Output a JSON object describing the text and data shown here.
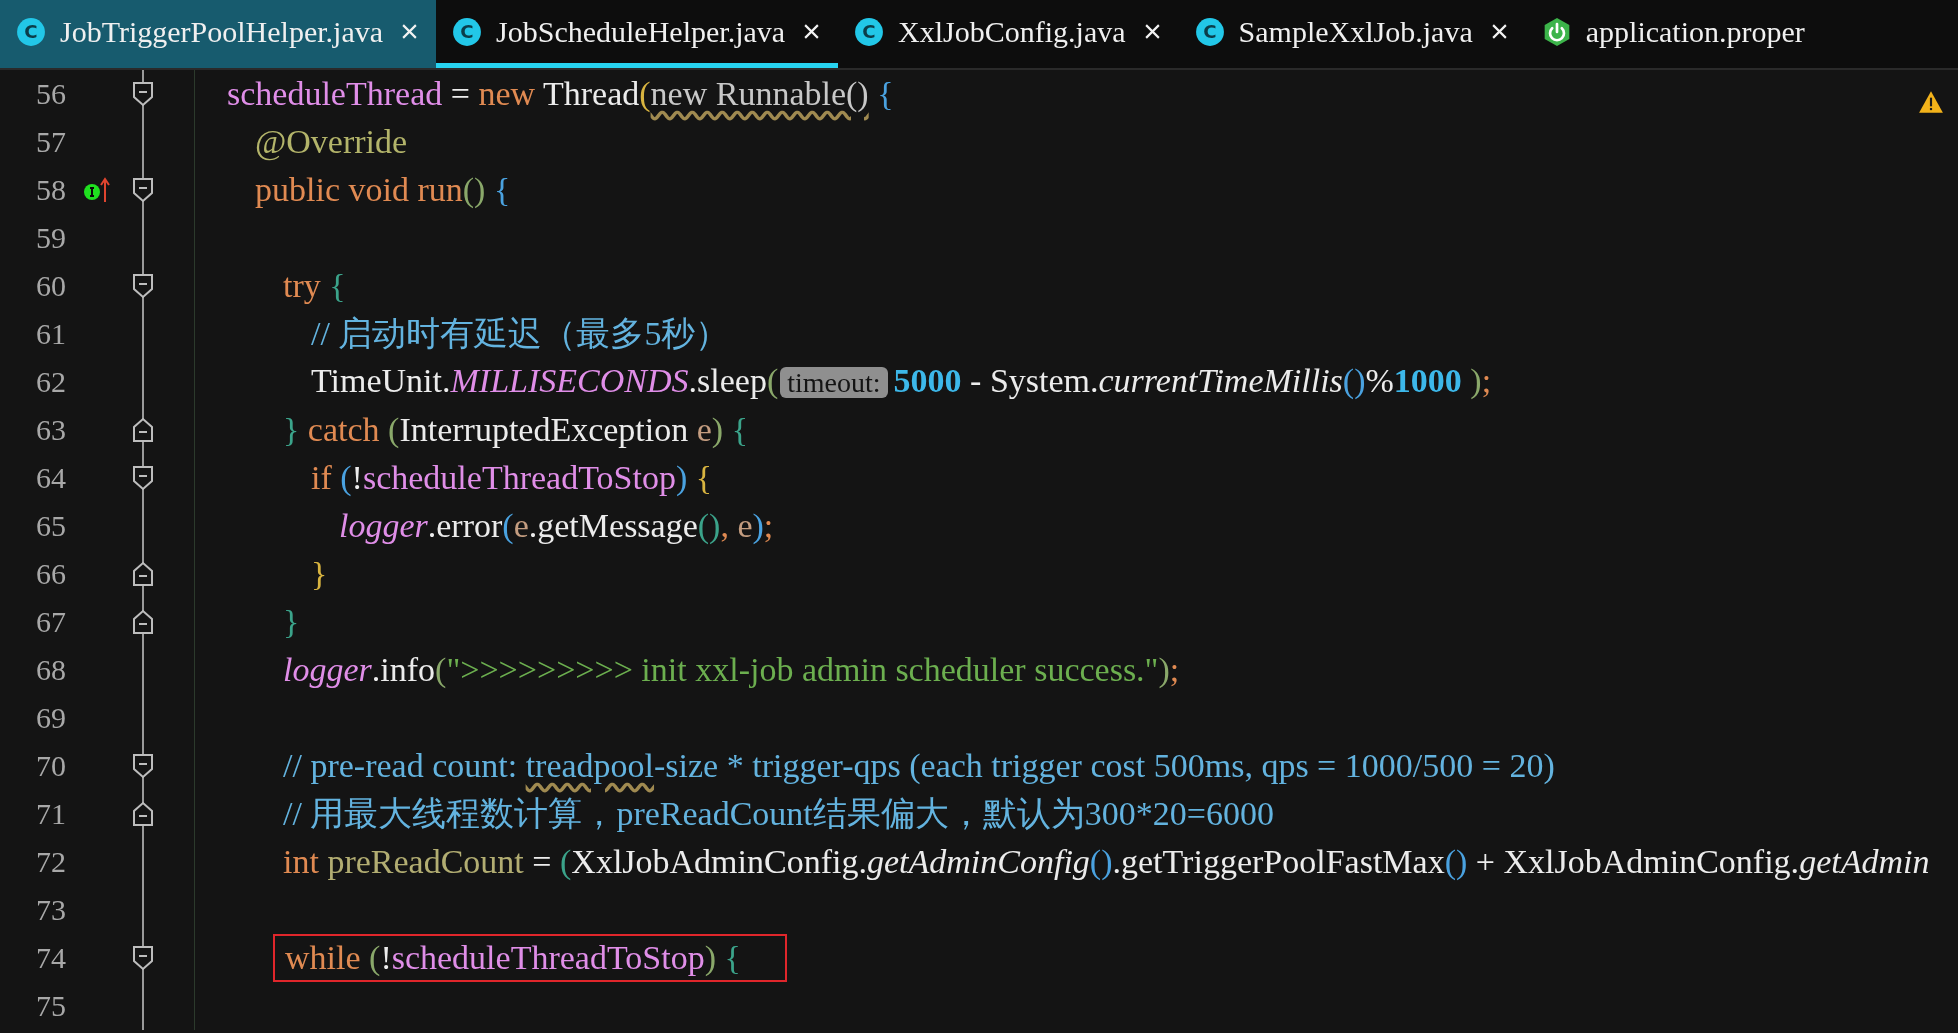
{
  "tabs": [
    {
      "label": "JobTriggerPoolHelper.java",
      "kind": "class",
      "icon_text": "C",
      "selected": false,
      "highlighted": true
    },
    {
      "label": "JobScheduleHelper.java",
      "kind": "class",
      "icon_text": "C",
      "selected": true,
      "highlighted": false
    },
    {
      "label": "XxlJobConfig.java",
      "kind": "class",
      "icon_text": "C",
      "selected": false,
      "highlighted": false
    },
    {
      "label": "SampleXxlJob.java",
      "kind": "class",
      "icon_text": "C",
      "selected": false,
      "highlighted": false
    },
    {
      "label": "application.proper",
      "kind": "spring",
      "selected": false,
      "highlighted": false
    }
  ],
  "editor": {
    "warning": true,
    "lines": [
      {
        "number": "56",
        "fold_start": true,
        "fold_end": false,
        "implements": false,
        "boxed": false,
        "tokens": [
          {
            "t": "scheduleThread",
            "kind": "field"
          },
          {
            "t": " = ",
            "kind": "plain"
          },
          {
            "t": "new",
            "kind": "kw"
          },
          {
            "t": " Thread",
            "kind": "plain"
          },
          {
            "t": "(",
            "kind": "b1"
          },
          {
            "t": "new Runnable()",
            "kind": "dimwavy"
          },
          {
            "t": " {",
            "kind": "b2"
          }
        ]
      },
      {
        "number": "57",
        "fold_start": false,
        "fold_end": false,
        "implements": false,
        "boxed": false,
        "tokens": [
          {
            "t": "\t@Override",
            "kind": "ann"
          }
        ]
      },
      {
        "number": "58",
        "fold_start": true,
        "fold_end": false,
        "implements": true,
        "boxed": false,
        "tokens": [
          {
            "t": "\tpublic void run",
            "kind": "kw"
          },
          {
            "t": "()",
            "kind": "b4"
          },
          {
            "t": " {",
            "kind": "b2"
          }
        ]
      },
      {
        "number": "59",
        "fold_start": false,
        "fold_end": false,
        "implements": false,
        "boxed": false
      },
      {
        "number": "60",
        "fold_start": true,
        "fold_end": false,
        "implements": false,
        "boxed": false,
        "tokens": [
          {
            "t": "\t\ttry",
            "kind": "kw"
          },
          {
            "t": " {",
            "kind": "b3"
          }
        ]
      },
      {
        "number": "61",
        "fold_start": false,
        "fold_end": false,
        "implements": false,
        "boxed": false,
        "tokens": [
          {
            "t": "\t\t\t// 启动时有延迟（最多5秒）",
            "kind": "cmt"
          }
        ]
      },
      {
        "number": "62",
        "fold_start": false,
        "fold_end": false,
        "implements": false,
        "boxed": false,
        "tokens": [
          {
            "t": "\t\t\tTimeUnit.",
            "kind": "plain"
          },
          {
            "t": "MILLISECONDS",
            "kind": "static"
          },
          {
            "t": ".sleep",
            "kind": "plain"
          },
          {
            "t": "(",
            "kind": "b4"
          },
          {
            "t": "timeout:",
            "kind": "hint"
          },
          {
            "t": "5000",
            "kind": "num"
          },
          {
            "t": " - System.",
            "kind": "plain"
          },
          {
            "t": "currentTimeMillis",
            "kind": "ital"
          },
          {
            "t": "()",
            "kind": "b2"
          },
          {
            "t": "%",
            "kind": "plain"
          },
          {
            "t": "1000",
            "kind": "num"
          },
          {
            "t": " )",
            "kind": "b4"
          },
          {
            "t": ";",
            "kind": "kw"
          }
        ]
      },
      {
        "number": "63",
        "fold_start": false,
        "fold_end": true,
        "implements": false,
        "boxed": false,
        "tokens": [
          {
            "t": "\t\t}",
            "kind": "b3"
          },
          {
            "t": " catch ",
            "kind": "kw"
          },
          {
            "t": "(",
            "kind": "b4"
          },
          {
            "t": "InterruptedException ",
            "kind": "plain"
          },
          {
            "t": "e",
            "kind": "param"
          },
          {
            "t": ")",
            "kind": "b4"
          },
          {
            "t": " {",
            "kind": "b3"
          }
        ]
      },
      {
        "number": "64",
        "fold_start": true,
        "fold_end": false,
        "implements": false,
        "boxed": false,
        "tokens": [
          {
            "t": "\t\t\tif ",
            "kind": "kw"
          },
          {
            "t": "(",
            "kind": "b2"
          },
          {
            "t": "!",
            "kind": "plain"
          },
          {
            "t": "scheduleThreadToStop",
            "kind": "field"
          },
          {
            "t": ")",
            "kind": "b2"
          },
          {
            "t": " {",
            "kind": "b1"
          }
        ]
      },
      {
        "number": "65",
        "fold_start": false,
        "fold_end": false,
        "implements": false,
        "boxed": false,
        "tokens": [
          {
            "t": "\t\t\t\tlogger",
            "kind": "static"
          },
          {
            "t": ".error",
            "kind": "plain"
          },
          {
            "t": "(",
            "kind": "b2"
          },
          {
            "t": "e",
            "kind": "param"
          },
          {
            "t": ".getMessage",
            "kind": "plain"
          },
          {
            "t": "()",
            "kind": "b3"
          },
          {
            "t": ",",
            "kind": "kw"
          },
          {
            "t": " e",
            "kind": "param"
          },
          {
            "t": ")",
            "kind": "b2"
          },
          {
            "t": ";",
            "kind": "kw"
          }
        ]
      },
      {
        "number": "66",
        "fold_start": false,
        "fold_end": true,
        "implements": false,
        "boxed": false,
        "tokens": [
          {
            "t": "\t\t\t}",
            "kind": "b1"
          }
        ]
      },
      {
        "number": "67",
        "fold_start": false,
        "fold_end": true,
        "implements": false,
        "boxed": false,
        "tokens": [
          {
            "t": "\t\t}",
            "kind": "b3"
          }
        ]
      },
      {
        "number": "68",
        "fold_start": false,
        "fold_end": false,
        "implements": false,
        "boxed": false,
        "tokens": [
          {
            "t": "\t\tlogger",
            "kind": "static"
          },
          {
            "t": ".info",
            "kind": "plain"
          },
          {
            "t": "(",
            "kind": "b4"
          },
          {
            "t": "\">>>>>>>>> init xxl-job admin scheduler success.\"",
            "kind": "str"
          },
          {
            "t": ")",
            "kind": "b4"
          },
          {
            "t": ";",
            "kind": "kw"
          }
        ]
      },
      {
        "number": "69",
        "fold_start": false,
        "fold_end": false,
        "implements": false,
        "boxed": false
      },
      {
        "number": "70",
        "fold_start": true,
        "fold_end": false,
        "implements": false,
        "boxed": false,
        "tokens": [
          {
            "t": "\t\t// pre-read count: ",
            "kind": "cmt"
          },
          {
            "t": "treadpool",
            "kind": "cmtwavy"
          },
          {
            "t": "-size * trigger-qps (each trigger cost 500ms, qps = 1000/500 = 20)",
            "kind": "cmt"
          }
        ]
      },
      {
        "number": "71",
        "fold_start": false,
        "fold_end": true,
        "implements": false,
        "boxed": false,
        "tokens": [
          {
            "t": "\t\t// 用最大线程数计算，preReadCount结果偏大，默认为300*20=6000",
            "kind": "cmt"
          }
        ]
      },
      {
        "number": "72",
        "fold_start": false,
        "fold_end": false,
        "implements": false,
        "boxed": false,
        "tokens": [
          {
            "t": "\t\tint",
            "kind": "kw"
          },
          {
            "t": " preReadCount",
            "kind": "local"
          },
          {
            "t": " = ",
            "kind": "plain"
          },
          {
            "t": "(",
            "kind": "b3"
          },
          {
            "t": "XxlJobAdminConfig.",
            "kind": "plain"
          },
          {
            "t": "getAdminConfig",
            "kind": "ital"
          },
          {
            "t": "()",
            "kind": "b2"
          },
          {
            "t": ".getTriggerPoolFastMax",
            "kind": "plain"
          },
          {
            "t": "()",
            "kind": "b2"
          },
          {
            "t": " + XxlJobAdminConfig.",
            "kind": "plain"
          },
          {
            "t": "getAdmin",
            "kind": "ital"
          }
        ]
      },
      {
        "number": "73",
        "fold_start": false,
        "fold_end": false,
        "implements": false,
        "boxed": false
      },
      {
        "number": "74",
        "fold_start": true,
        "fold_end": false,
        "implements": false,
        "boxed": true,
        "tokens": [
          {
            "t": "while",
            "kind": "kw"
          },
          {
            "t": " (",
            "kind": "b4"
          },
          {
            "t": "!",
            "kind": "plain"
          },
          {
            "t": "scheduleThreadToStop",
            "kind": "field"
          },
          {
            "t": ")",
            "kind": "b4"
          },
          {
            "t": " {",
            "kind": "b3"
          }
        ]
      },
      {
        "number": "75",
        "fold_start": false,
        "fold_end": false,
        "implements": false,
        "boxed": false
      }
    ]
  }
}
